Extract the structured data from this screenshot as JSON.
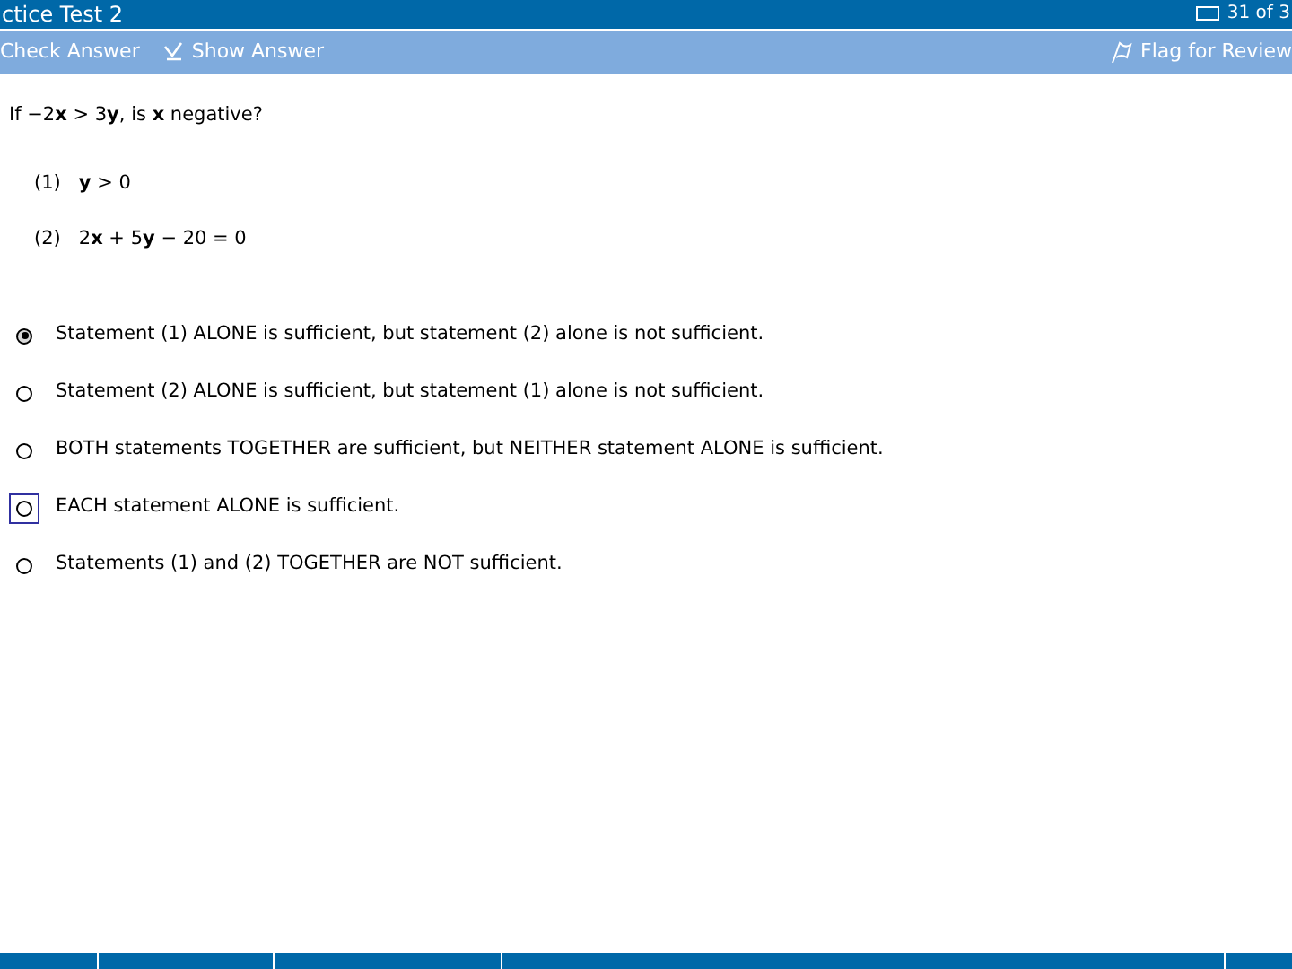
{
  "window": {
    "title": "ctice Test 2",
    "progress": "31 of 3"
  },
  "toolbar": {
    "left": [
      {
        "kind": "text",
        "label": "Check Answer"
      },
      {
        "kind": "icon",
        "label": "Show Answer"
      }
    ],
    "right": {
      "label": "Flag for Review"
    }
  },
  "question": {
    "stem": "If −2**x** > 3**y**, is **x** negative?",
    "statements": [
      {
        "number": "(1)",
        "text": "**y** > 0"
      },
      {
        "number": "(2)",
        "text": "2**x** + 5**y** − 20 = 0"
      }
    ]
  },
  "options": [
    {
      "text": "Statement (1) ALONE is sufficient, but statement (2) alone is not sufficient.",
      "selected": true,
      "focused": false
    },
    {
      "text": "Statement (2) ALONE is sufficient, but statement (1) alone is not sufficient.",
      "selected": false,
      "focused": false
    },
    {
      "text": "BOTH statements TOGETHER are sufficient, but NEITHER statement ALONE is sufficient.",
      "selected": false,
      "focused": false
    },
    {
      "text": "EACH statement ALONE is sufficient.",
      "selected": false,
      "focused": true
    },
    {
      "text": "Statements (1) and (2) TOGETHER are NOT sufficient.",
      "selected": false,
      "focused": false
    }
  ]
}
